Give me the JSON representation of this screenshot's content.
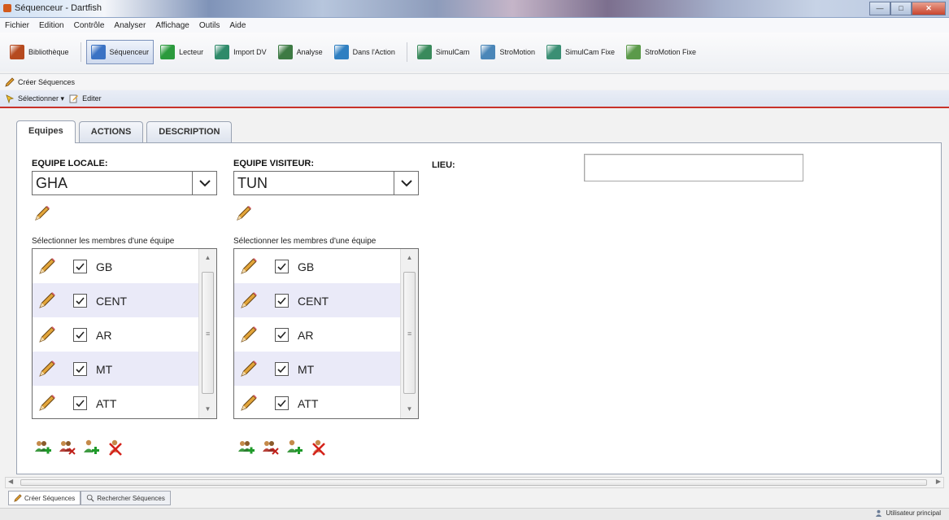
{
  "window": {
    "title": "Séquenceur - Dartfish"
  },
  "menu": [
    "Fichier",
    "Edition",
    "Contrôle",
    "Analyser",
    "Affichage",
    "Outils",
    "Aide"
  ],
  "toolbar": [
    {
      "label": "Bibliothèque",
      "icon": "library-icon",
      "color": "#b64a1f",
      "active": false
    },
    {
      "label": "Séquenceur",
      "icon": "sequencer-icon",
      "color": "#3a72c4",
      "active": true
    },
    {
      "label": "Lecteur",
      "icon": "player-icon",
      "color": "#2b9a3d",
      "active": false
    },
    {
      "label": "Import DV",
      "icon": "import-dv-icon",
      "color": "#2f8a6a",
      "active": false
    },
    {
      "label": "Analyse",
      "icon": "analyse-icon",
      "color": "#3d7a44",
      "active": false
    },
    {
      "label": "Dans l'Action",
      "icon": "in-action-icon",
      "color": "#2f7fc1",
      "active": false
    },
    {
      "label": "SimulCam",
      "icon": "simulcam-icon",
      "color": "#3a8a5c",
      "active": false
    },
    {
      "label": "StroMotion",
      "icon": "stromotion-icon",
      "color": "#4a86b8",
      "active": false
    },
    {
      "label": "SimulCam Fixe",
      "icon": "simulcam-fixe-icon",
      "color": "#3b8f74",
      "active": false
    },
    {
      "label": "StroMotion Fixe",
      "icon": "stromotion-fixe-icon",
      "color": "#5b9a4a",
      "active": false
    }
  ],
  "subbar1": {
    "create_label": "Créer Séquences"
  },
  "subbar2": {
    "select_label": "Sélectionner ▾",
    "edit_label": "Editer"
  },
  "tabs": [
    "Equipes",
    "ACTIONS",
    "DESCRIPTION"
  ],
  "home_team": {
    "label": "EQUIPE LOCALE:",
    "value": "GHA",
    "members_label": "Sélectionner les membres d'une équipe",
    "members": [
      {
        "name": "GB",
        "checked": true
      },
      {
        "name": "CENT",
        "checked": true
      },
      {
        "name": "AR",
        "checked": true
      },
      {
        "name": "MT",
        "checked": true
      },
      {
        "name": "ATT",
        "checked": true
      }
    ]
  },
  "away_team": {
    "label": "EQUIPE VISITEUR:",
    "value": "TUN",
    "members_label": "Sélectionner les membres d'une équipe",
    "members": [
      {
        "name": "GB",
        "checked": true
      },
      {
        "name": "CENT",
        "checked": true
      },
      {
        "name": "AR",
        "checked": true
      },
      {
        "name": "MT",
        "checked": true
      },
      {
        "name": "ATT",
        "checked": true
      }
    ]
  },
  "lieu": {
    "label": "LIEU:",
    "value": ""
  },
  "bottom_tabs": [
    "Créer Séquences",
    "Rechercher Séquences"
  ],
  "status": {
    "user": "Utilisateur principal"
  },
  "colors": {
    "accent_line": "#c8322a",
    "row_alt": "#eaeaf8",
    "tab_border": "#9aa3b3"
  }
}
